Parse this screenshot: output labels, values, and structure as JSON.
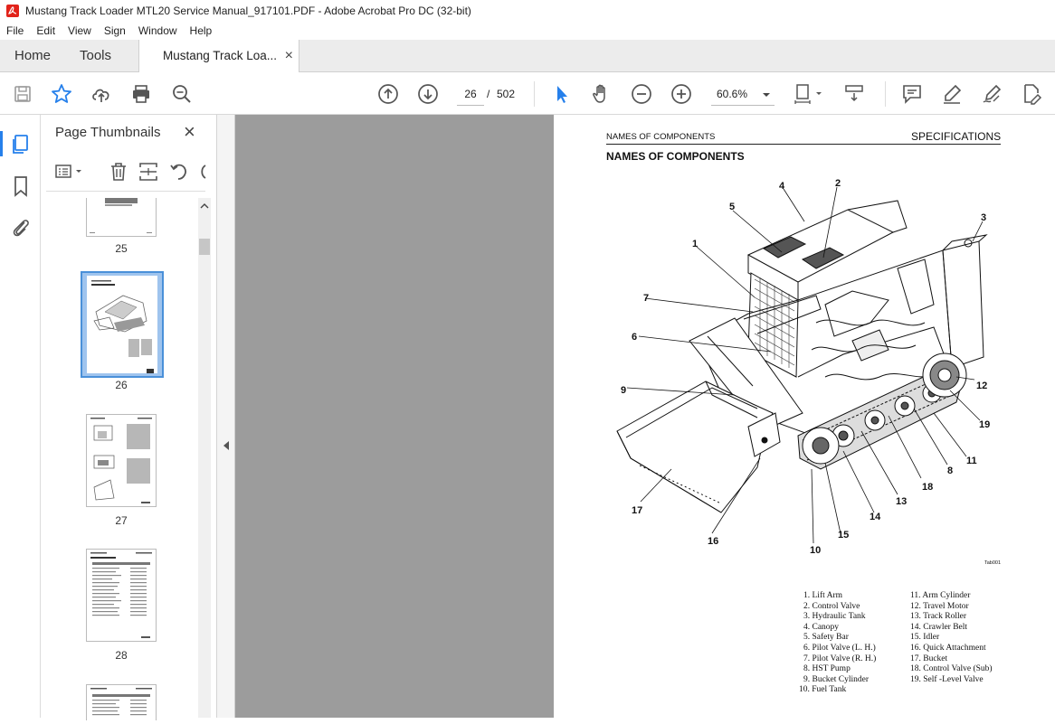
{
  "window": {
    "title": "Mustang Track Loader MTL20 Service Manual_917101.PDF - Adobe Acrobat Pro DC (32-bit)"
  },
  "menu": [
    "File",
    "Edit",
    "View",
    "Sign",
    "Window",
    "Help"
  ],
  "tabs": {
    "home": "Home",
    "tools": "Tools",
    "document": "Mustang Track Loa...",
    "close_glyph": "×"
  },
  "toolbar": {
    "current_page": "26",
    "page_separator": "/",
    "total_pages": "502",
    "zoom": "60.6%"
  },
  "panel": {
    "title": "Page Thumbnails",
    "close_glyph": "×",
    "thumbnails": [
      {
        "label": "25"
      },
      {
        "label": "26",
        "selected": true
      },
      {
        "label": "27"
      },
      {
        "label": "28"
      }
    ]
  },
  "document_page": {
    "header_left": "NAMES OF COMPONENTS",
    "header_right": "SPECIFICATIONS",
    "heading": "NAMES OF COMPONENTS",
    "figure_id": "Tab001",
    "callouts": [
      "1",
      "2",
      "3",
      "4",
      "5",
      "6",
      "7",
      "8",
      "9",
      "10",
      "11",
      "12",
      "13",
      "14",
      "15",
      "16",
      "17",
      "18",
      "19"
    ],
    "legend_left": [
      "1. Lift Arm",
      "2. Control Valve",
      "3. Hydraulic Tank",
      "4. Canopy",
      "5. Safety Bar",
      "6. Pilot Valve (L. H.)",
      "7. Pilot Valve (R. H.)",
      "8. HST Pump",
      "9. Bucket Cylinder",
      "10. Fuel Tank"
    ],
    "legend_right": [
      "11. Arm Cylinder",
      "12. Travel Motor",
      "13. Track Roller",
      "14. Crawler Belt",
      "15. Idler",
      "16. Quick Attachment",
      "17. Bucket",
      "18. Control Valve (Sub)",
      "19. Self -Level Valve"
    ]
  },
  "colors": {
    "accent_red": "#e2231a",
    "selection_blue": "#2680eb",
    "canvas_gray": "#9c9c9c"
  }
}
